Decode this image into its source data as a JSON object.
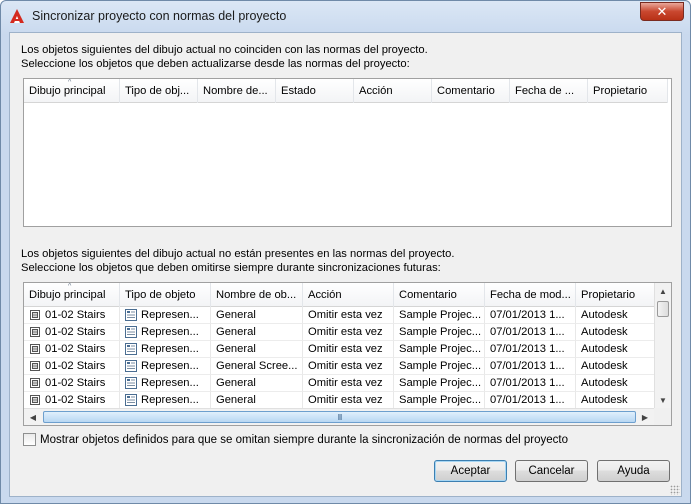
{
  "window": {
    "title": "Sincronizar proyecto con normas del proyecto",
    "icon": "autocad-logo-icon",
    "close_glyph": "✕"
  },
  "top_section": {
    "line1": "Los objetos siguientes del dibujo actual no coinciden con las normas del proyecto.",
    "line2": "Seleccione los objetos que deben actualizarse desde las normas del proyecto:",
    "columns": [
      "Dibujo principal",
      "Tipo de obj...",
      "Nombre de...",
      "Estado",
      "Acción",
      "Comentario",
      "Fecha de ...",
      "Propietario"
    ],
    "rows": []
  },
  "bottom_section": {
    "line1": "Los objetos siguientes del dibujo actual no están presentes en las normas del proyecto.",
    "line2": "Seleccione los objetos que deben omitirse siempre durante sincronizaciones futuras:",
    "columns": [
      "Dibujo principal",
      "Tipo de objeto",
      "Nombre de ob...",
      "Acción",
      "Comentario",
      "Fecha de mod...",
      "Propietario"
    ],
    "rows": [
      {
        "drawing": "01-02 Stairs",
        "type": "Represen...",
        "name": "General",
        "action": "Omitir esta vez",
        "comment": "Sample Projec...",
        "date": "07/01/2013 1...",
        "owner": "Autodesk"
      },
      {
        "drawing": "01-02 Stairs",
        "type": "Represen...",
        "name": "General",
        "action": "Omitir esta vez",
        "comment": "Sample Projec...",
        "date": "07/01/2013 1...",
        "owner": "Autodesk"
      },
      {
        "drawing": "01-02 Stairs",
        "type": "Represen...",
        "name": "General",
        "action": "Omitir esta vez",
        "comment": "Sample Projec...",
        "date": "07/01/2013 1...",
        "owner": "Autodesk"
      },
      {
        "drawing": "01-02 Stairs",
        "type": "Represen...",
        "name": "General Scree...",
        "action": "Omitir esta vez",
        "comment": "Sample Projec...",
        "date": "07/01/2013 1...",
        "owner": "Autodesk"
      },
      {
        "drawing": "01-02 Stairs",
        "type": "Represen...",
        "name": "General",
        "action": "Omitir esta vez",
        "comment": "Sample Projec...",
        "date": "07/01/2013 1...",
        "owner": "Autodesk"
      },
      {
        "drawing": "01-02 Stairs",
        "type": "Represen...",
        "name": "General",
        "action": "Omitir esta vez",
        "comment": "Sample Projec...",
        "date": "07/01/2013 1...",
        "owner": "Autodesk"
      }
    ],
    "scroll_up": "▲",
    "scroll_down": "▼",
    "scroll_left": "◀",
    "scroll_right": "▶",
    "thumb_grip": "III"
  },
  "checkbox": {
    "label": "Mostrar objetos definidos para que se omitan siempre durante la sincronización de normas del proyecto",
    "checked": false
  },
  "buttons": {
    "accept": "Aceptar",
    "cancel": "Cancelar",
    "help": "Ayuda"
  },
  "colors": {
    "accent": "#3c7fb1",
    "close": "#c9472f"
  }
}
